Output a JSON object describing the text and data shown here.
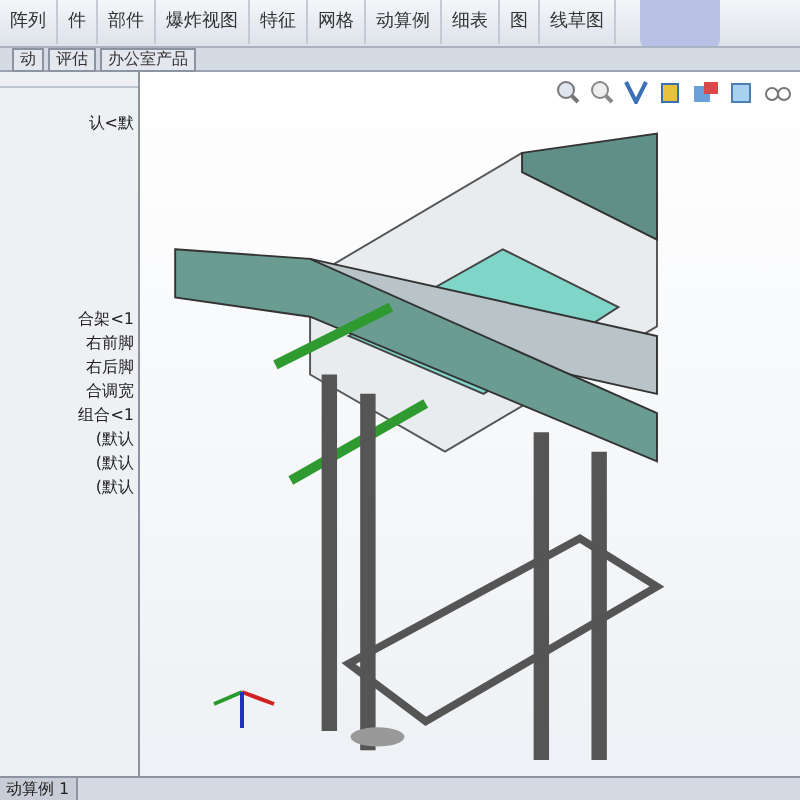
{
  "ribbon": {
    "commands": [
      {
        "label": "阵列"
      },
      {
        "label": "件"
      },
      {
        "label": "部件"
      },
      {
        "label": "爆炸视图"
      },
      {
        "label": "特征"
      },
      {
        "label": "网格"
      },
      {
        "label": "动算例"
      },
      {
        "label": "细表"
      },
      {
        "label": "图"
      },
      {
        "label": "线草图"
      }
    ]
  },
  "command_tabs": [
    {
      "label": "动",
      "selected": false
    },
    {
      "label": "评估",
      "selected": false
    },
    {
      "label": "办公室产品",
      "selected": false
    }
  ],
  "feature_tree": {
    "items": [
      {
        "label": "认<默"
      },
      {
        "label": "合架<1"
      },
      {
        "label": "右前脚"
      },
      {
        "label": "右后脚"
      },
      {
        "label": "合调宽"
      },
      {
        "label": "组合<1"
      },
      {
        "label": "(默认"
      },
      {
        "label": "(默认"
      },
      {
        "label": "(默认"
      }
    ]
  },
  "bottom_tabs": [
    {
      "label": "动算例 1",
      "selected": true
    }
  ]
}
